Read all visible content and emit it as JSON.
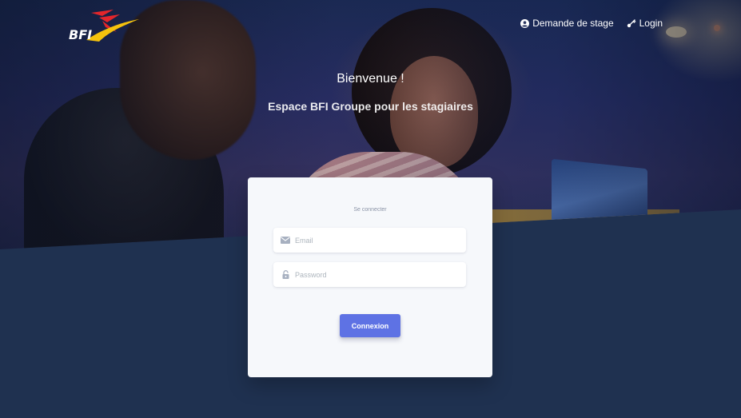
{
  "brand": {
    "logo_text": "BFI",
    "logo_icon": "bfi-star-logo",
    "colors": {
      "red": "#e3262b",
      "yellow": "#f4c20d",
      "white": "#ffffff"
    }
  },
  "nav": {
    "items": [
      {
        "label": "Demande de stage",
        "icon": "user-circle-icon"
      },
      {
        "label": "Login",
        "icon": "key-icon"
      }
    ]
  },
  "hero": {
    "title": "Bienvenue !",
    "subtitle": "Espace BFI Groupe pour les stagiaires"
  },
  "login": {
    "heading": "Se connecter",
    "email": {
      "value": "",
      "placeholder": "Email",
      "icon": "envelope-icon"
    },
    "password": {
      "value": "",
      "placeholder": "Password",
      "icon": "lock-icon"
    },
    "submit_label": "Connexion"
  },
  "theme": {
    "background": "#1f3150",
    "card": "#f6f8fb",
    "accent": "#5e72e4"
  }
}
